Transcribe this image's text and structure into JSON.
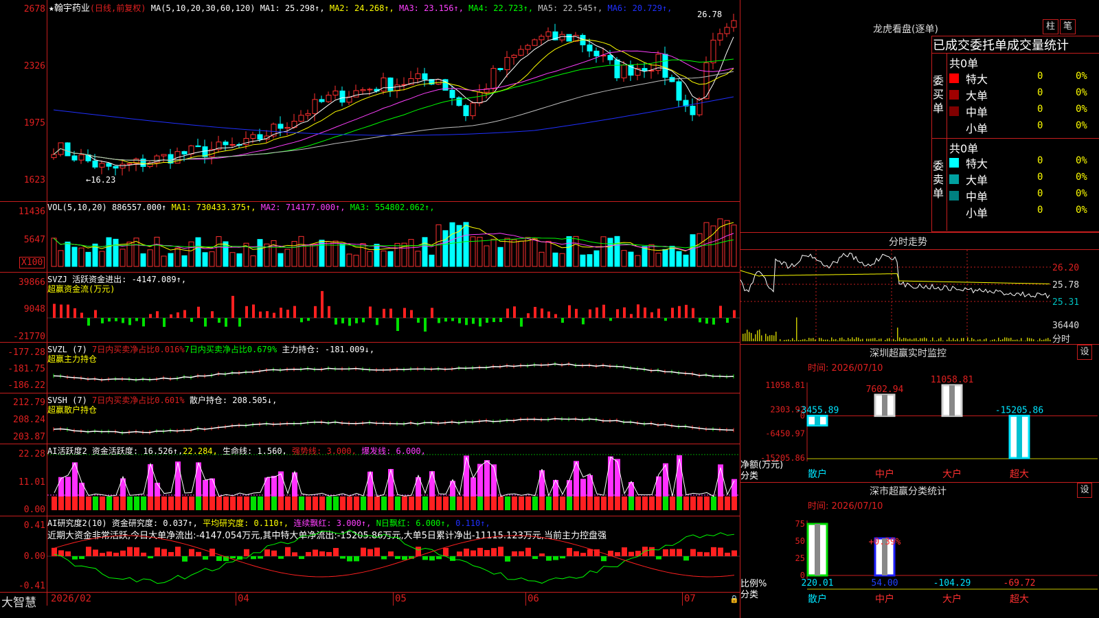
{
  "main": {
    "title_prefix": "★翰宇药业",
    "title_mode": "(日线,前复权)",
    "ma_label": "MA(5,10,20,30,60,120)",
    "ma": [
      {
        "name": "MA1",
        "val": "25.298↑",
        "color": "#ffffff"
      },
      {
        "name": "MA2",
        "val": "24.268↑",
        "color": "#ffff00"
      },
      {
        "name": "MA3",
        "val": "23.156↑",
        "color": "#ff40ff"
      },
      {
        "name": "MA4",
        "val": "22.723↑",
        "color": "#00ff00"
      },
      {
        "name": "MA5",
        "val": "22.545↑",
        "color": "#c0c0c0"
      },
      {
        "name": "MA6",
        "val": "20.729↑",
        "color": "#2030ff"
      }
    ],
    "y_ticks": [
      "2678",
      "2326",
      "1975",
      "1623"
    ],
    "high_label": "26.78",
    "low_label": "←16.23"
  },
  "vol": {
    "label": "VOL(5,10,20)",
    "value": "886557.000↑",
    "ma": [
      {
        "name": "MA1",
        "val": "730433.375↑",
        "color": "#ffff00"
      },
      {
        "name": "MA2",
        "val": "714177.000↑",
        "color": "#ff40ff"
      },
      {
        "name": "MA3",
        "val": "554802.062↑",
        "color": "#00ff00"
      }
    ],
    "y_ticks": [
      "11436",
      "5647"
    ],
    "unit": "X100"
  },
  "svzj": {
    "label": "SVZJ  活跃资金进出: -4147.089↑,",
    "sub": "超赢资金流(万元)",
    "y_ticks": [
      "39866",
      "9048",
      "-21770"
    ]
  },
  "svzl": {
    "label": "SVZL (7)",
    "a": "7日内买卖净占比0.016%",
    "b": "7日内买卖净占比0.679%",
    "c": "主力持仓: -181.009↓,",
    "sub": "超赢主力持仓",
    "y_ticks": [
      "-177.28",
      "-181.75",
      "-186.22"
    ]
  },
  "svsh": {
    "label": "SVSH (7)",
    "a": "7日内买卖净占比0.601%",
    "c": "散户持仓: 208.505↓,",
    "sub": "超赢散户持仓",
    "y_ticks": [
      "212.79",
      "208.24",
      "203.87"
    ]
  },
  "ai1": {
    "label": "AI活跃度2",
    "a": "资金活跃度: 16.526↑,",
    "b": "22.284,",
    "c": "生命线: 1.560,",
    "d": "强势线: 3.000,",
    "e": "爆发线: 6.000,",
    "y_ticks": [
      "22.28",
      "11.01",
      "0.00"
    ]
  },
  "ai2": {
    "label": "AI研究度2(10)",
    "a": "资金研究度: 0.037↑,",
    "b": "平均研究度: 0.110↑,",
    "c": "连续飘红: 3.000↑,",
    "d": "N日飘红: 6.000↑,",
    "e": "0.110↑,",
    "note": "近期大资金非常活跃,今日大单净流出:-4147.054万元,其中特大单净流出:-15205.86万元,大单5日累计净出-11115.123万元,当前主力控盘强",
    "y_ticks": [
      "0.41",
      "0.00",
      "-0.41"
    ]
  },
  "bottom": {
    "brand": "大智慧",
    "dates": [
      "2026/02",
      "04",
      "05",
      "06",
      "07"
    ]
  },
  "lhkp": {
    "title": "龙虎看盘(逐单)",
    "btn1": "柱",
    "btn2": "笔",
    "subtitle": "已成交委托单成交量统计",
    "buy_side": "委买单",
    "sell_side": "委卖单",
    "buy_total": "共0单",
    "sell_total": "共0单",
    "buy_rows": [
      {
        "name": "特大",
        "color": "#ff0000",
        "val": "0",
        "pct": "0%"
      },
      {
        "name": "大单",
        "color": "#a00000",
        "val": "0",
        "pct": "0%"
      },
      {
        "name": "中单",
        "color": "#800000",
        "val": "0",
        "pct": "0%"
      },
      {
        "name": "小单",
        "color": "#000000",
        "val": "0",
        "pct": "0%"
      }
    ],
    "sell_rows": [
      {
        "name": "特大",
        "color": "#00ffff",
        "val": "0",
        "pct": "0%"
      },
      {
        "name": "大单",
        "color": "#00a0a0",
        "val": "0",
        "pct": "0%"
      },
      {
        "name": "中单",
        "color": "#008080",
        "val": "0",
        "pct": "0%"
      },
      {
        "name": "小单",
        "color": "#000000",
        "val": "0",
        "pct": "0%"
      }
    ]
  },
  "fenshi": {
    "title": "分时走势",
    "y_ticks": [
      "26.20",
      "25.78",
      "25.31"
    ],
    "vol_tick": "36440",
    "vol_label": "分时"
  },
  "monitor": {
    "title": "深圳超赢实时监控",
    "btn": "设",
    "time": "时间: 2026/07/10",
    "y_ticks": [
      "11058.81",
      "2303.92",
      "0",
      "-6450.97",
      "-15205.86"
    ],
    "ylabel": "净额(万元)",
    "xlabel": "分类",
    "categories": [
      "散户",
      "中户",
      "大户",
      "超大"
    ],
    "values": [
      "-3455.89",
      "7602.94",
      "11058.81",
      "-15205.86"
    ]
  },
  "classify": {
    "title": "深市超赢分类统计",
    "btn": "设",
    "time": "时间: 2026/07/10",
    "y_ticks": [
      "75",
      "50",
      "25",
      "0"
    ],
    "ylabel": "比例%",
    "xlabel": "分类",
    "categories": [
      "散户",
      "中户",
      "大户",
      "超大"
    ],
    "values": [
      "220.01",
      "54.00",
      "-104.29",
      "-69.72"
    ],
    "annot": "+0.39%"
  },
  "chart_data": [
    {
      "type": "bar",
      "title": "深圳超赢实时监控",
      "ylabel": "净额(万元)",
      "xlabel": "分类",
      "categories": [
        "散户",
        "中户",
        "大户",
        "超大"
      ],
      "values": [
        -3455.89,
        7602.94,
        11058.81,
        -15205.86
      ],
      "ylim": [
        -15205.86,
        11058.81
      ]
    },
    {
      "type": "bar",
      "title": "深市超赢分类统计",
      "ylabel": "比例%",
      "xlabel": "分类",
      "categories": [
        "散户",
        "中户",
        "大户",
        "超大"
      ],
      "values": [
        220.01,
        54.0,
        -104.29,
        -69.72
      ],
      "ylim": [
        0,
        75
      ]
    }
  ]
}
